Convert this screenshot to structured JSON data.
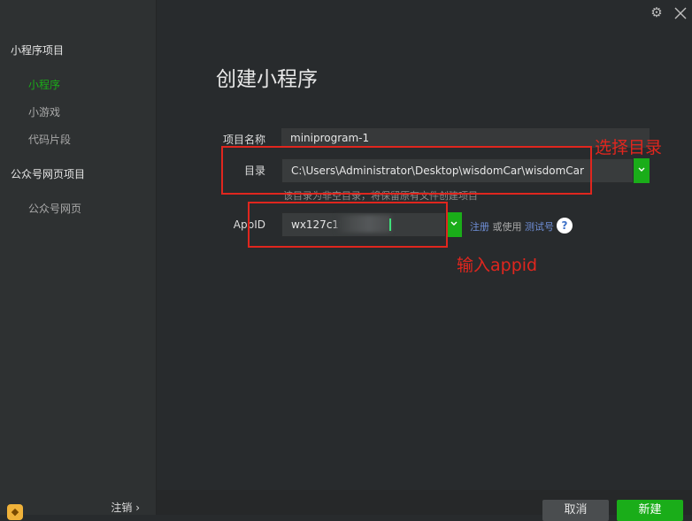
{
  "sidebar": {
    "group1": "小程序项目",
    "items1": [
      "小程序",
      "小游戏",
      "代码片段"
    ],
    "group2": "公众号网页项目",
    "items2": [
      "公众号网页"
    ],
    "logout": "注销 ›"
  },
  "title": "创建小程序",
  "form": {
    "name_label": "项目名称",
    "name_value": "miniprogram-1",
    "dir_label": "目录",
    "dir_value": "C:\\Users\\Administrator\\Desktop\\wisdomCar\\wisdomCar",
    "dir_hint": "该目录为非空目录，将保留原有文件创建项目",
    "appid_label": "AppID",
    "appid_value": "wx127c1f6",
    "register": "注册",
    "or_use": "或使用",
    "test_account": "测试号",
    "help": "?"
  },
  "annotations": {
    "choose_dir": "选择目录",
    "enter_appid": "输入appid"
  },
  "buttons": {
    "cancel": "取消",
    "create": "新建"
  },
  "icons": {
    "gear": "gear-icon",
    "close": "close-icon",
    "dropdown": "chevron-down-icon"
  },
  "colors": {
    "accent": "#1aad19",
    "annotation": "#e0261e"
  }
}
